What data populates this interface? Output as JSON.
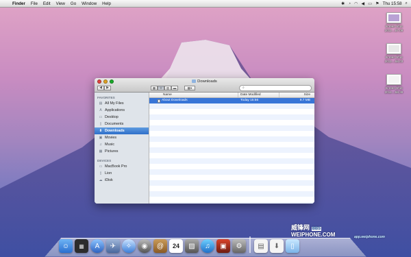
{
  "menubar": {
    "apple": "",
    "app": "Finder",
    "menus": [
      "File",
      "Edit",
      "View",
      "Go",
      "Window",
      "Help"
    ],
    "clock": "Thu 15:58"
  },
  "desktop_icons": [
    {
      "label1": "Screen Shot",
      "label2": "2011-...57.09"
    },
    {
      "label1": "Screen Shot",
      "label2": "2011-...58.03"
    },
    {
      "label1": "Screen Shot",
      "label2": "2011-...58.38"
    }
  ],
  "finder": {
    "title": "Downloads",
    "nav_back": "◀",
    "nav_forward": "▶",
    "search_placeholder": "",
    "sidebar": {
      "favorites_header": "FAVORITES",
      "favorites": [
        {
          "label": "All My Files",
          "icon": "▤"
        },
        {
          "label": "Applications",
          "icon": "A"
        },
        {
          "label": "Desktop",
          "icon": "▭"
        },
        {
          "label": "Documents",
          "icon": "▯"
        },
        {
          "label": "Downloads",
          "icon": "⬇"
        },
        {
          "label": "Movies",
          "icon": "▣"
        },
        {
          "label": "Music",
          "icon": "♫"
        },
        {
          "label": "Pictures",
          "icon": "▦"
        }
      ],
      "devices_header": "DEVICES",
      "devices": [
        {
          "label": "MacBook Pro",
          "icon": "▭"
        },
        {
          "label": "Lion",
          "icon": "▯"
        },
        {
          "label": "iDisk",
          "icon": "☁"
        }
      ]
    },
    "columns": {
      "name": "Name",
      "date": "Date Modified",
      "size": "Size"
    },
    "rows": [
      {
        "name": "About Downloads",
        "date": "Today 15:56",
        "size": "9.7 MB"
      }
    ]
  },
  "watermark": {
    "chinese": "威锋网",
    "bbs": "BBS",
    "brand": "WEIPHONE.COM",
    "url": "app.weiphone.com"
  },
  "colors": {
    "selection": "#3875d7",
    "sidebar_bg": "#dfe4ea"
  }
}
